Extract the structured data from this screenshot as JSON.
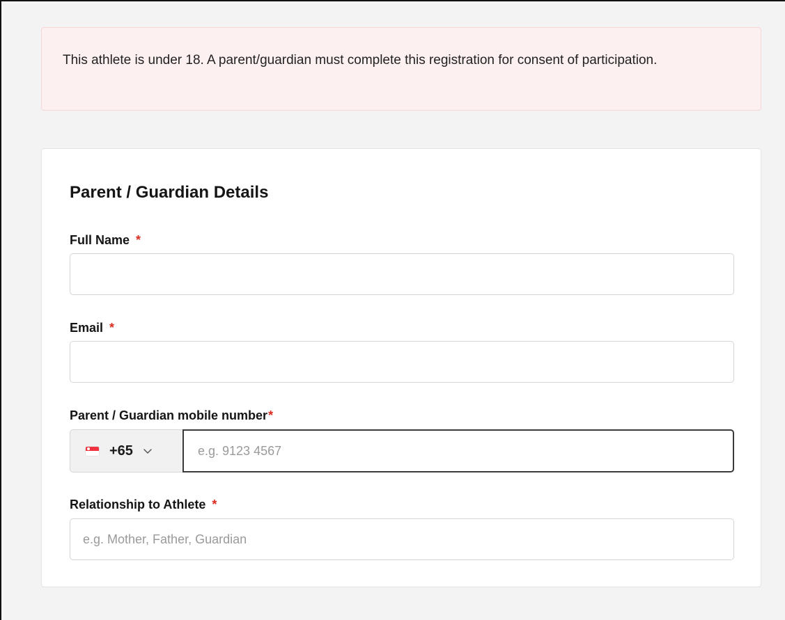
{
  "alert": {
    "message": "This athlete is under 18. A parent/guardian must complete this registration for consent of participation."
  },
  "card": {
    "title": "Parent / Guardian Details"
  },
  "fields": {
    "full_name": {
      "label": "Full Name",
      "required_mark": "*",
      "value": "",
      "placeholder": ""
    },
    "email": {
      "label": "Email",
      "required_mark": "*",
      "value": "",
      "placeholder": ""
    },
    "mobile": {
      "label": "Parent / Guardian mobile number",
      "required_mark": "*",
      "country_flag": "singapore-flag-icon",
      "dial_code": "+65",
      "value": "",
      "placeholder": "e.g. 9123 4567"
    },
    "relationship": {
      "label": "Relationship to Athlete",
      "required_mark": "*",
      "value": "",
      "placeholder": "e.g. Mother, Father, Guardian"
    }
  },
  "colors": {
    "page_background": "#f3f3f3",
    "alert_background": "#fdf0f0",
    "alert_border": "#f5d7d7",
    "required_mark": "#d92d20",
    "focused_input_border": "#3a3a3a"
  }
}
